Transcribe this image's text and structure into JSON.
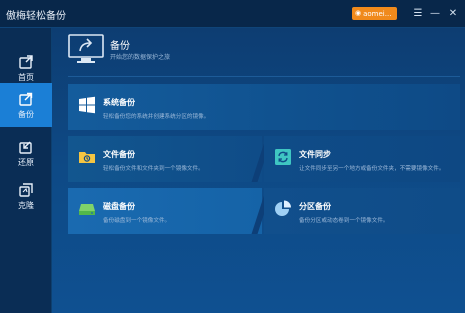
{
  "window": {
    "title": "傲梅轻松备份"
  },
  "titlebar": {
    "user_label": "aomei...",
    "menu_glyph": "☰",
    "min_glyph": "—",
    "close_glyph": "✕"
  },
  "sidebar": {
    "items": [
      {
        "label": "首页",
        "icon": "home-icon"
      },
      {
        "label": "备份",
        "icon": "backup-icon",
        "active": true
      },
      {
        "label": "还原",
        "icon": "restore-icon"
      },
      {
        "label": "克隆",
        "icon": "clone-icon"
      }
    ]
  },
  "header": {
    "title": "备份",
    "subtitle": "开始您的数据保护之旅"
  },
  "cards": {
    "system": {
      "title": "系统备份",
      "desc": "轻松备份您的系统并创建系统分区的镜像。"
    },
    "file": {
      "title": "文件备份",
      "desc": "轻松备份文件和文件夹到一个镜像文件。"
    },
    "sync": {
      "title": "文件同步",
      "desc": "让文件同步至另一个地方或备份文件夹，不需要镜像文件。"
    },
    "disk": {
      "title": "磁盘备份",
      "desc": "备份磁盘到一个镜像文件。"
    },
    "partition": {
      "title": "分区备份",
      "desc": "备份分区或动态卷到一个镜像文件。"
    }
  },
  "colors": {
    "accent": "#1b7fd6",
    "user_pill": "#f08a1c",
    "background": "#0d3a6b"
  }
}
